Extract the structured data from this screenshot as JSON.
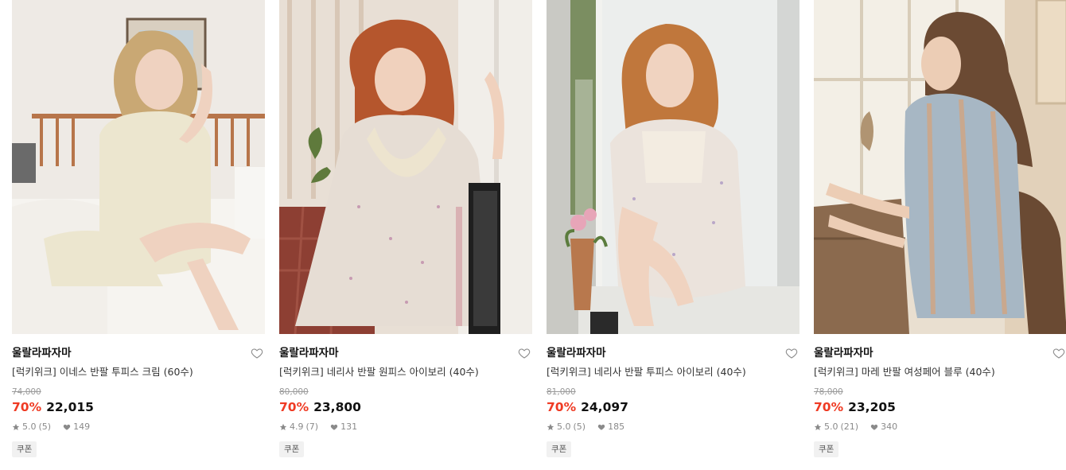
{
  "products": [
    {
      "brand": "울랄라파자마",
      "name": "[럭키위크] 이네스 반팔 투피스 크림 (60수)",
      "original_price": "74,000",
      "discount": "70%",
      "price": "22,015",
      "rating": "5.0",
      "reviews": "(5)",
      "likes": "149",
      "badge": "쿠폰",
      "colors": {
        "wall": "#e9e4de",
        "garment": "#ece6cf",
        "hair": "#c9a874",
        "bed": "#f6f4f0"
      }
    },
    {
      "brand": "울랄라파자마",
      "name": "[럭키위크] 네리사 반팔 원피스 아이보리 (40수)",
      "original_price": "80,000",
      "discount": "70%",
      "price": "23,800",
      "rating": "4.9",
      "reviews": "(7)",
      "likes": "131",
      "badge": "쿠폰",
      "colors": {
        "wall": "#e7ddd2",
        "garment": "#e6ddd4",
        "hair": "#b5562d",
        "bed": "#7a3b32"
      }
    },
    {
      "brand": "울랄라파자마",
      "name": "[럭키위크] 네리사 반팔 투피스 아이보리 (40수)",
      "original_price": "81,000",
      "discount": "70%",
      "price": "24,097",
      "rating": "5.0",
      "reviews": "(5)",
      "likes": "185",
      "badge": "쿠폰",
      "colors": {
        "wall": "#dfe0de",
        "garment": "#ebe3dc",
        "hair": "#c0773c",
        "bed": "#ececea"
      }
    },
    {
      "brand": "울랄라파자마",
      "name": "[럭키위크] 마레 반팔 여성페어 블루 (40수)",
      "original_price": "78,000",
      "discount": "70%",
      "price": "23,205",
      "rating": "5.0",
      "reviews": "(21)",
      "likes": "340",
      "badge": "쿠폰",
      "colors": {
        "wall": "#e8dccb",
        "garment": "#a7b7c4",
        "hair": "#6b4a33",
        "bed": "#8b6a4e"
      }
    }
  ],
  "accent_color": "#ef3b24"
}
